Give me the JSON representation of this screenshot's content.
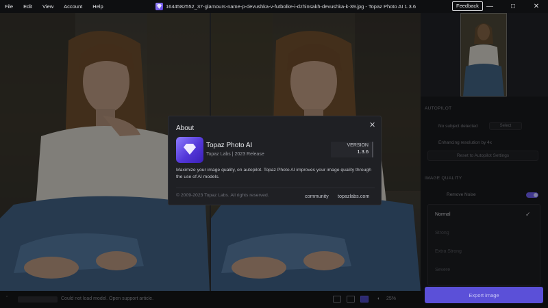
{
  "menu": [
    "File",
    "Edit",
    "View",
    "Account",
    "Help"
  ],
  "window": {
    "title": "1644582552_37-glamours-name-p-devushka-v-futbolke-i-dzhinsakh-devushka-k-39.jpg - Topaz Photo AI 1.3.6",
    "feedback": "Feedback",
    "icons": [
      "minimize-icon",
      "maximize-icon",
      "close-icon"
    ]
  },
  "panel": {
    "autopilot_label": "AUTOPILOT",
    "no_subject": "No subject detected",
    "select_label": "Select",
    "enhancing": "Enhancing resolution by 4x",
    "reset_label": "Reset to Autopilot Settings",
    "image_quality_label": "IMAGE QUALITY",
    "remove_noise": "Remove Noise",
    "modes": [
      "Normal",
      "Strong",
      "Extra Strong",
      "Severe"
    ],
    "selected_mode": "Normal",
    "export_label": "Export image"
  },
  "status": {
    "message": "Could not load model. Open support article.",
    "zoom": "25%"
  },
  "about": {
    "heading": "About",
    "app_name": "Topaz Photo AI",
    "publisher": "Topaz Labs | 2023 Release",
    "version_label": "VERSION",
    "version": "1.3.6",
    "description": "Maximize your image quality, on autopilot. Topaz Photo AI improves your image quality through the use of AI models.",
    "copyright": "© 2009-2023 Topaz Labs. All rights reserved.",
    "links": [
      "community",
      "topazlabs.com"
    ]
  }
}
